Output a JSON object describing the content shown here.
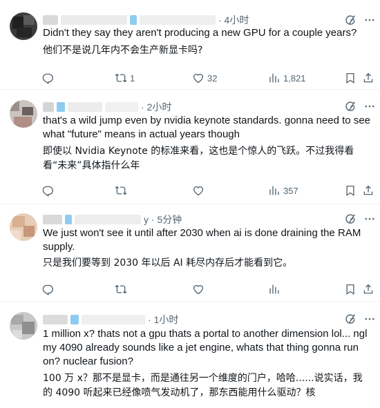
{
  "tweets": [
    {
      "time": "· 4小时",
      "text": "Didn't they say they aren't producing a new GPU for a couple years?",
      "translation": "他们不是说几年内不会生产新显卡吗?",
      "stats": {
        "replies": "",
        "reposts": "1",
        "likes": "32",
        "views": "1,821"
      }
    },
    {
      "time": "· 2小时",
      "text": "that's a wild jump even by nvidia keynote standards. gonna need to see what \"future\" means in actual years though",
      "translation": "即使以 Nvidia Keynote 的标准来看，这也是个惊人的飞跃。不过我得看看“未来”具体指什么年",
      "stats": {
        "replies": "",
        "reposts": "",
        "likes": "",
        "views": "357"
      }
    },
    {
      "time": "y · 5分钟",
      "text": "We just won't see it until after 2030 when ai is done draining the RAM supply.",
      "translation": "只是我们要等到 2030 年以后 AI 耗尽内存后才能看到它。",
      "stats": {
        "replies": "",
        "reposts": "",
        "likes": "",
        "views": ""
      }
    },
    {
      "time": "· 1小时",
      "text": "1 million x? thats not a gpu thats a portal to another dimension lol... ngl my 4090 already sounds like a jet engine, whats that thing gonna run on? nuclear fusion?",
      "translation": "100 万 x？那不是显卡，而是通往另一个维度的门户，哈哈......说实话，我的 4090 听起来已经像喷气发动机了，那东西能用什么驱动？核"
    }
  ],
  "icons": {
    "reply": "reply-icon",
    "repost": "repost-icon",
    "like": "heart-icon",
    "views": "views-icon",
    "bookmark": "bookmark-icon",
    "share": "share-icon",
    "grok": "grok-icon",
    "more": "more-icon"
  },
  "colors": {
    "text": "#0f1419",
    "secondary": "#536471",
    "divider": "#eff3f4",
    "redacted_blue": "#8ecbf0"
  }
}
